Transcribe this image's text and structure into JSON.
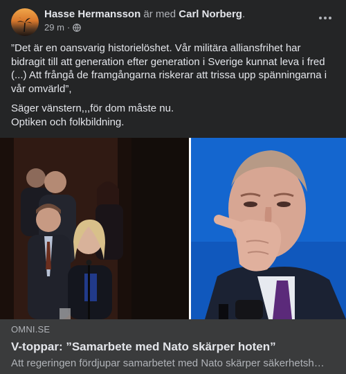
{
  "post": {
    "author": "Hasse Hermansson",
    "with_text": "är med",
    "tagged": "Carl Norberg",
    "tagged_suffix": ".",
    "time": "29 m",
    "separator": "·",
    "audience_icon": "globe-icon",
    "more_icon": "more-horizontal-icon",
    "text_paragraph_1": [
      "”Det är en oansvarig historielöshet. Vår militära alliansfrihet har",
      "bidragit till att generation efter generation i Sverige kunnat leva i fred",
      "(...) Att frångå de framgångarna riskerar att trissa upp spänningarna i",
      "vår omvärld”,"
    ],
    "text_paragraph_2": [
      "Säger vänstern,,,för dom måste nu.",
      "Optiken och folkbildning."
    ]
  },
  "link_preview": {
    "domain": "OMNI.SE",
    "title": "V-toppar: ”Samarbete med Nato skärper hoten”",
    "description": "Att regeringen fördjupar samarbetet med Nato skärper säkerhetsh…"
  },
  "colors": {
    "background": "#242526",
    "preview_background": "#3a3b3c",
    "primary_text": "#e4e6eb",
    "secondary_text": "#b0b3b8"
  }
}
